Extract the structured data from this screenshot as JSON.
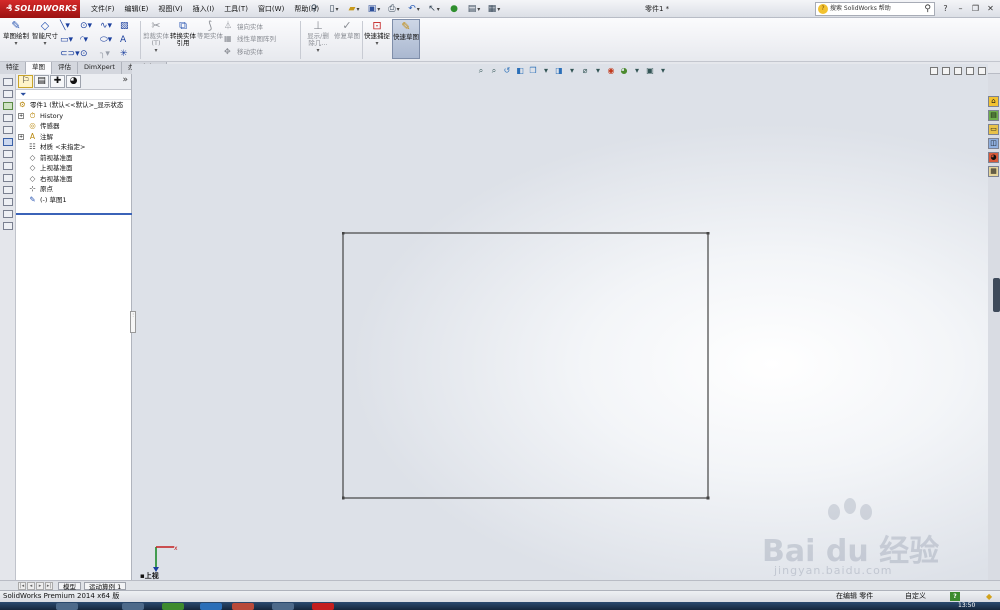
{
  "app": {
    "brand": "SOLIDWORKS",
    "document_title": "零件1 *",
    "search_placeholder": "搜索 SolidWorks 帮助"
  },
  "menu": [
    "文件(F)",
    "编辑(E)",
    "视图(V)",
    "插入(I)",
    "工具(T)",
    "窗口(W)",
    "帮助(H)"
  ],
  "commands": {
    "sketch": "草图绘制",
    "smart_dimension": "智能尺寸",
    "trim": "剪裁实体(T)",
    "convert": "转换实体引用",
    "offset": "等距实体",
    "mirror": "镜向实体",
    "linear_pattern": "线性草图阵列",
    "move": "移动实体",
    "display_delete": "显示/删除几...",
    "repair": "修复草图",
    "quick_snap": "快速捕捉",
    "rapid_sketch": "快速草图"
  },
  "tabs": [
    "特征",
    "草图",
    "评估",
    "DimXpert",
    "办公室产品"
  ],
  "active_tab": 1,
  "feature_tree": [
    {
      "label": "零件1 (默认<<默认>_显示状态",
      "icon": "part-icon",
      "level": 0,
      "expand": false
    },
    {
      "label": "History",
      "icon": "history-icon",
      "level": 1,
      "expand": true
    },
    {
      "label": "传感器",
      "icon": "sensor-icon",
      "level": 1,
      "expand": false
    },
    {
      "label": "注解",
      "icon": "annotation-icon",
      "level": 1,
      "expand": true
    },
    {
      "label": "材质 <未指定>",
      "icon": "material-icon",
      "level": 1,
      "expand": false
    },
    {
      "label": "前视基准面",
      "icon": "plane-icon",
      "level": 1,
      "expand": false
    },
    {
      "label": "上视基准面",
      "icon": "plane-icon",
      "level": 1,
      "expand": false
    },
    {
      "label": "右视基准面",
      "icon": "plane-icon",
      "level": 1,
      "expand": false
    },
    {
      "label": "原点",
      "icon": "origin-icon",
      "level": 1,
      "expand": false
    },
    {
      "label": "(-) 草图1",
      "icon": "sketch-icon",
      "level": 1,
      "expand": false
    }
  ],
  "view": {
    "orientation_label": "上视",
    "sketch": "rectangle"
  },
  "bottom_tabs": [
    "模型",
    "运动算例 1"
  ],
  "status": {
    "app_version": "SolidWorks Premium 2014 x64 版",
    "mode": "在编辑 零件",
    "custom": "自定义",
    "clock": "13:50"
  },
  "watermark": {
    "brand": "Bai du 经验",
    "url": "jingyan.baidu.com"
  },
  "colors": {
    "accent": "#c41e1e",
    "selection_blue": "#3b63b8",
    "sketch_line": "#444444"
  }
}
